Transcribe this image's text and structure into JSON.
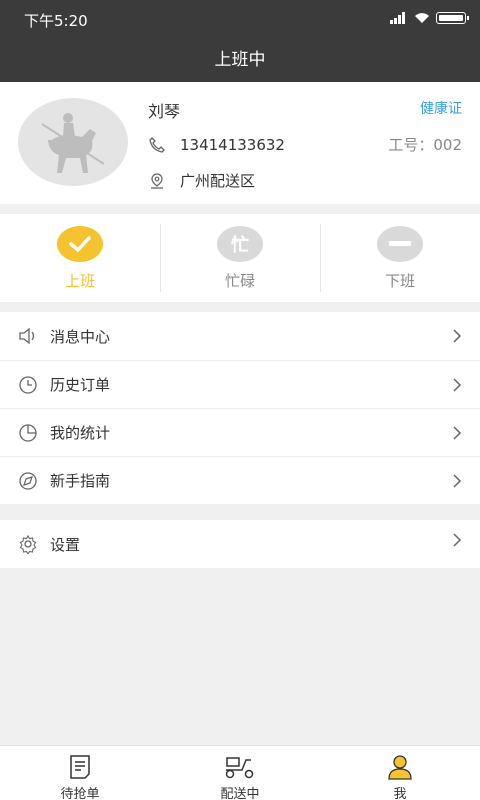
{
  "status_bar": {
    "time": "下午5:20"
  },
  "title": "上班中",
  "profile": {
    "name": "刘琴",
    "health_link": "健康证",
    "phone": "13414133632",
    "work_id": "工号：002",
    "location": "广州配送区"
  },
  "status": {
    "on_duty": "上班",
    "busy": "忙碌",
    "busy_glyph": "忙",
    "off_duty": "下班",
    "active": "on_duty"
  },
  "menu": {
    "messages": "消息中心",
    "history": "历史订单",
    "stats": "我的统计",
    "guide": "新手指南",
    "settings": "设置"
  },
  "tabs": {
    "grab": "待抢单",
    "delivering": "配送中",
    "me": "我",
    "active": "me"
  },
  "colors": {
    "accent": "#f5c230",
    "header": "#3b3b3b",
    "link": "#3aa0e0"
  }
}
